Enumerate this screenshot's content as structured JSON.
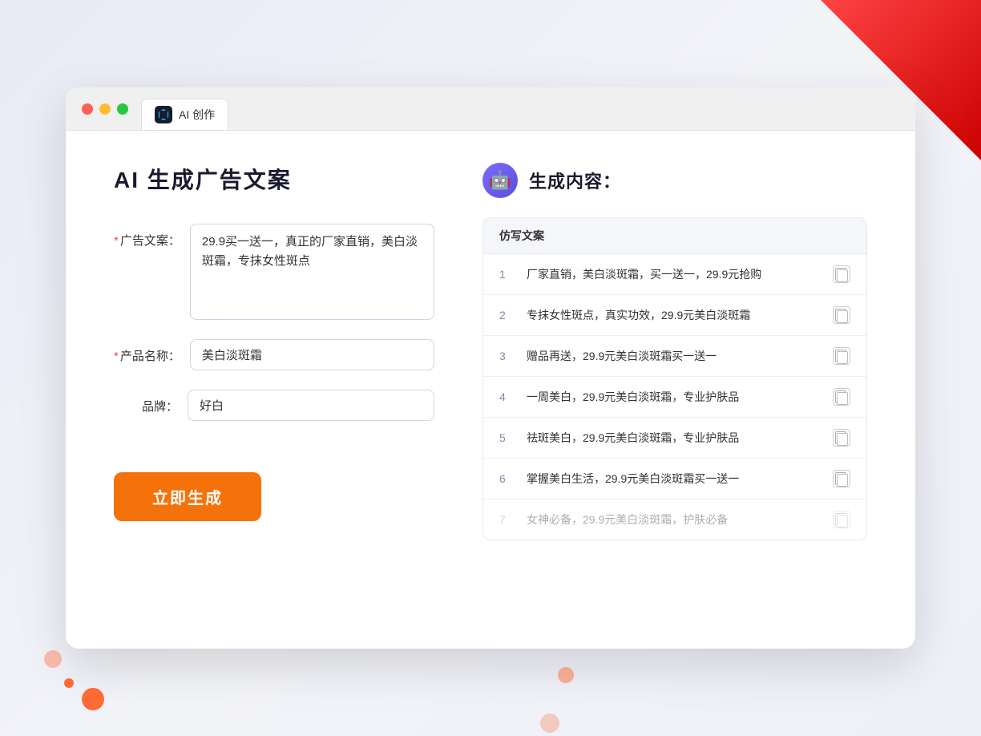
{
  "browser": {
    "tab_label": "AI 创作"
  },
  "page": {
    "title": "AI 生成广告文案",
    "result_title": "生成内容："
  },
  "form": {
    "ad_copy_label": "广告文案：",
    "product_name_label": "产品名称：",
    "brand_label": "品牌：",
    "ad_copy_required": true,
    "product_name_required": true,
    "ad_copy_value": "29.9买一送一，真正的厂家直销，美白淡斑霜，专抹女性斑点",
    "product_name_value": "美白淡斑霜",
    "brand_value": "好白",
    "generate_button": "立即生成"
  },
  "results": {
    "table_header": "仿写文案",
    "items": [
      {
        "id": 1,
        "text": "厂家直销，美白淡斑霜，买一送一，29.9元抢购",
        "faded": false
      },
      {
        "id": 2,
        "text": "专抹女性斑点，真实功效，29.9元美白淡斑霜",
        "faded": false
      },
      {
        "id": 3,
        "text": "赠品再送，29.9元美白淡斑霜买一送一",
        "faded": false
      },
      {
        "id": 4,
        "text": "一周美白，29.9元美白淡斑霜，专业护肤品",
        "faded": false
      },
      {
        "id": 5,
        "text": "祛斑美白，29.9元美白淡斑霜，专业护肤品",
        "faded": false
      },
      {
        "id": 6,
        "text": "掌握美白生活，29.9元美白淡斑霜买一送一",
        "faded": false
      },
      {
        "id": 7,
        "text": "女神必备，29.9元美白淡斑霜，护肤必备",
        "faded": true
      }
    ]
  },
  "colors": {
    "accent": "#f5720a",
    "brand_purple": "#5b4de0",
    "required": "#ff4444"
  }
}
